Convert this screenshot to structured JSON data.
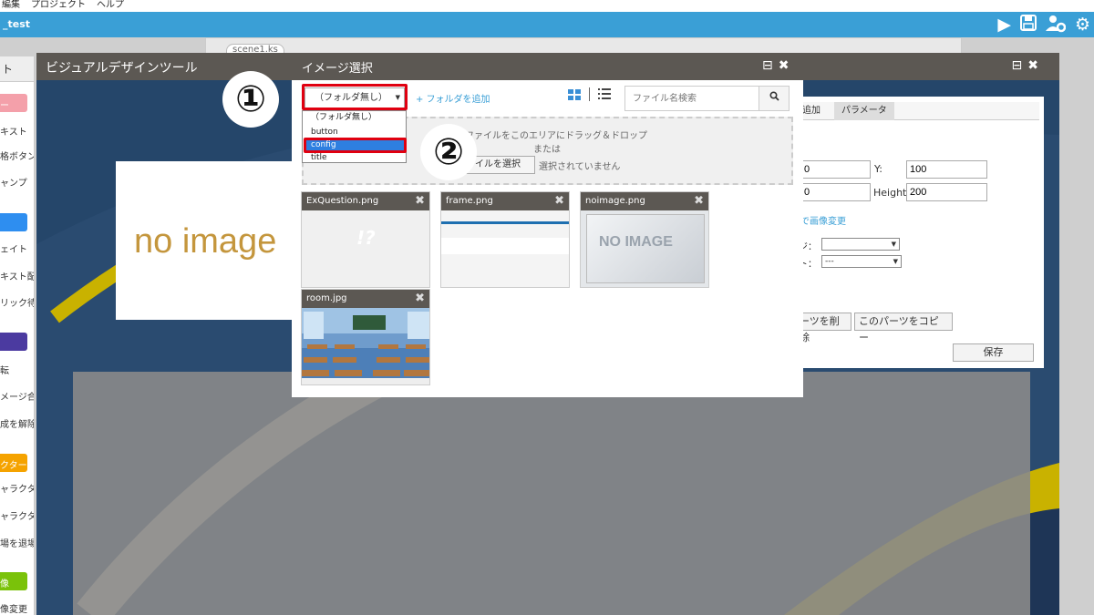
{
  "menu": [
    "編集",
    "プロジェクト",
    "ヘルプ"
  ],
  "app": {
    "title": "_test"
  },
  "toolbar": {
    "play_icon": "play-icon",
    "save_icon": "floppy-icon",
    "users_icon": "users-gear-icon",
    "gear_icon": "gear-icon"
  },
  "editor": {
    "tab_label": "scene1.ks"
  },
  "left_panel": {
    "tab": "ト",
    "items": [
      "ー",
      "キスト",
      "格ボタン",
      "ャンプ",
      "",
      "ェイト",
      "キスト配置",
      "リック待ち",
      "",
      "転",
      "メージ合成",
      "成を解除",
      "クター",
      "ャラクター",
      "ャラクター",
      "場を退場",
      "像",
      "像変更"
    ]
  },
  "vdt": {
    "title": "ビジュアルデザインツール",
    "noimage_text": "no image"
  },
  "props": {
    "tabs": [
      "追加",
      "パラメータ"
    ],
    "x_value": "0",
    "y_label": "Y:",
    "y_value": "100",
    "w_value": "0",
    "h_label": "Height:",
    "h_value": "200",
    "change_image": "で画像変更",
    "select1_label": "ジ：",
    "select1_value": "",
    "select2_label": "ト：",
    "select2_value": "---",
    "delete_btn": "ーツを削除",
    "copy_btn": "このパーツをコピー",
    "save_btn": "保存"
  },
  "dialog": {
    "title": "イメージ選択",
    "folder_select": "（フォルダ無し）",
    "add_folder": "+ フォルダを追加",
    "search_placeholder": "ファイル名検索",
    "drop_text": "ファイルをこのエリアにドラッグ＆ドロップ",
    "drop_or": "または",
    "file_btn": "ァイルを選択",
    "file_none": "選択されていません",
    "dropdown_options": [
      "（フォルダ無し）",
      "button",
      "config",
      "title"
    ],
    "selected_option": "config",
    "files": [
      {
        "name": "ExQuestion.png",
        "preview": "!?"
      },
      {
        "name": "frame.png",
        "preview": ""
      },
      {
        "name": "noimage.png",
        "preview": "NO IMAGE"
      },
      {
        "name": "room.jpg",
        "preview": ""
      }
    ]
  },
  "annotations": {
    "step1": "①",
    "step2": "②"
  },
  "colors": {
    "accent": "#3a9fd6",
    "header": "#5c5853",
    "highlight": "#e00010",
    "selected": "#2e7fe0"
  }
}
